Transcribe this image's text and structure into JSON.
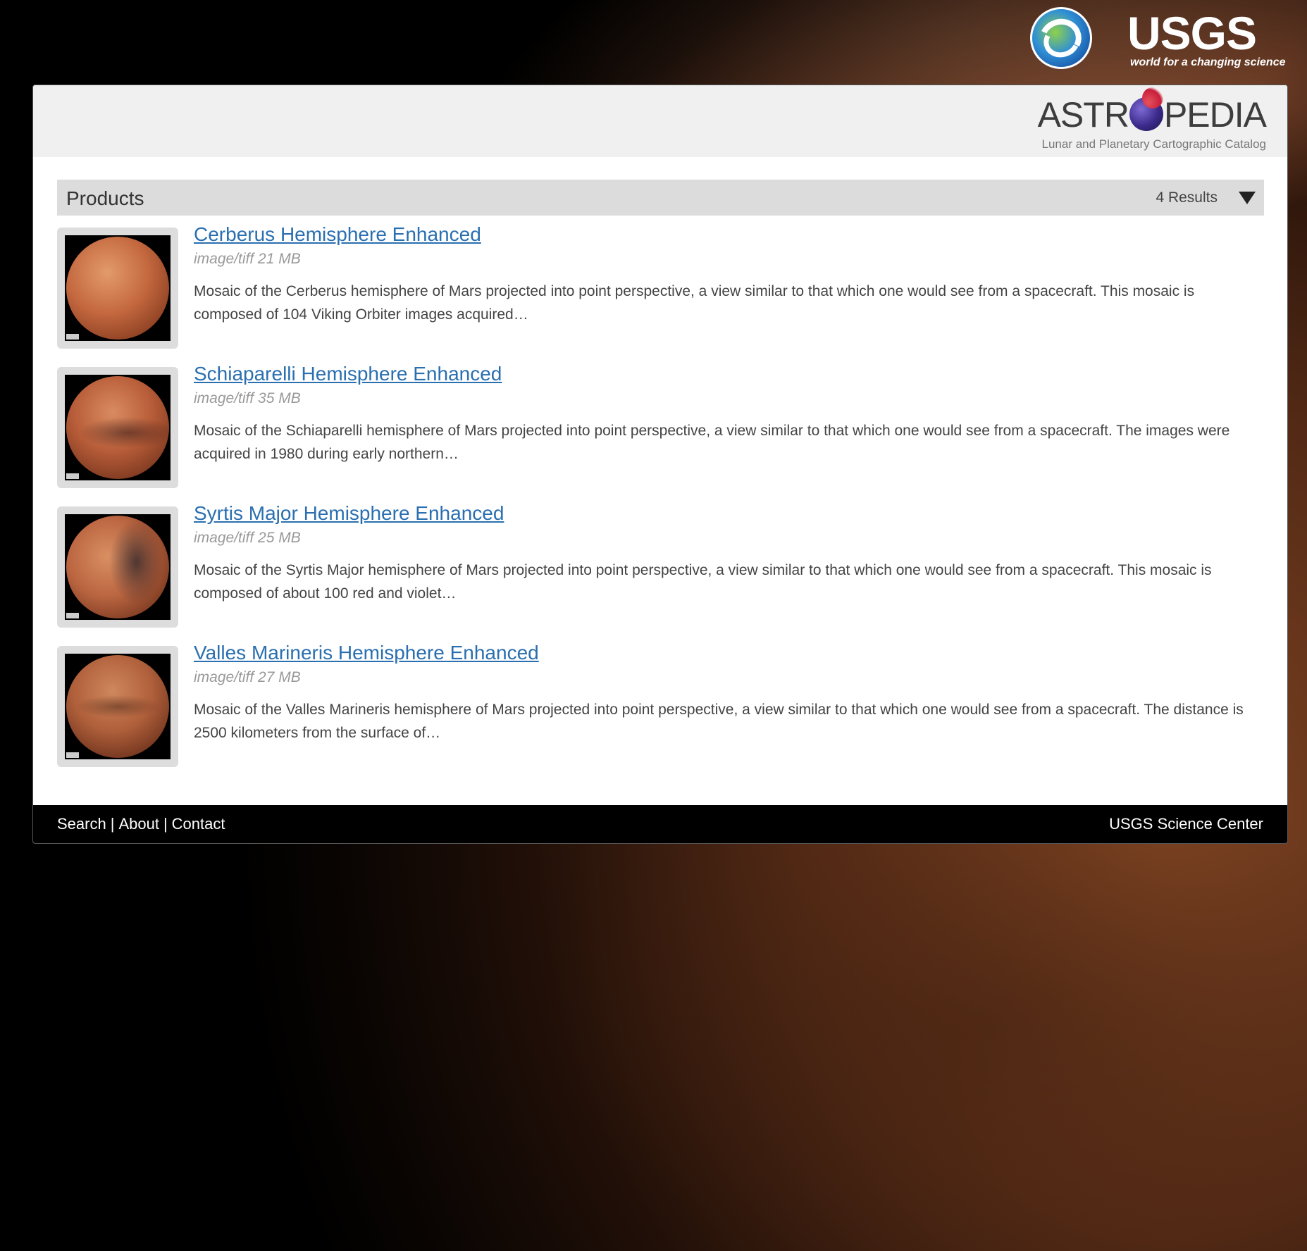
{
  "branding": {
    "usgs_name": "USGS",
    "usgs_tagline": "world for a changing science",
    "astro_prefix": "ASTR",
    "astro_suffix": "PEDIA",
    "astro_subtitle": "Lunar and Planetary Cartographic Catalog"
  },
  "products": {
    "title": "Products",
    "results": "4 Results",
    "items": [
      {
        "title": "Cerberus Hemisphere Enhanced",
        "meta": "image/tiff 21 MB",
        "description": "Mosaic of the Cerberus hemisphere of Mars projected into point perspective, a view similar to that which one would see from a spacecraft. This mosaic is composed of 104 Viking Orbiter images acquired…"
      },
      {
        "title": "Schiaparelli Hemisphere Enhanced",
        "meta": "image/tiff 35 MB",
        "description": "Mosaic of the Schiaparelli hemisphere of Mars projected into point perspective, a view similar to that which one would see from a spacecraft. The images were acquired in 1980 during early northern…"
      },
      {
        "title": "Syrtis Major Hemisphere Enhanced",
        "meta": "image/tiff 25 MB",
        "description": "Mosaic of the Syrtis Major hemisphere of Mars projected into point perspective, a view similar to that which one would see from a spacecraft. This mosaic is composed of about 100 red and violet…"
      },
      {
        "title": "Valles Marineris Hemisphere Enhanced",
        "meta": "image/tiff 27 MB",
        "description": "Mosaic of the Valles Marineris hemisphere of Mars projected into point perspective, a view similar to that which one would see from a spacecraft. The distance is 2500 kilometers from the surface of…"
      }
    ]
  },
  "footer": {
    "links": [
      "Search",
      "About",
      "Contact"
    ],
    "separator": "|",
    "right": "USGS Science Center"
  }
}
